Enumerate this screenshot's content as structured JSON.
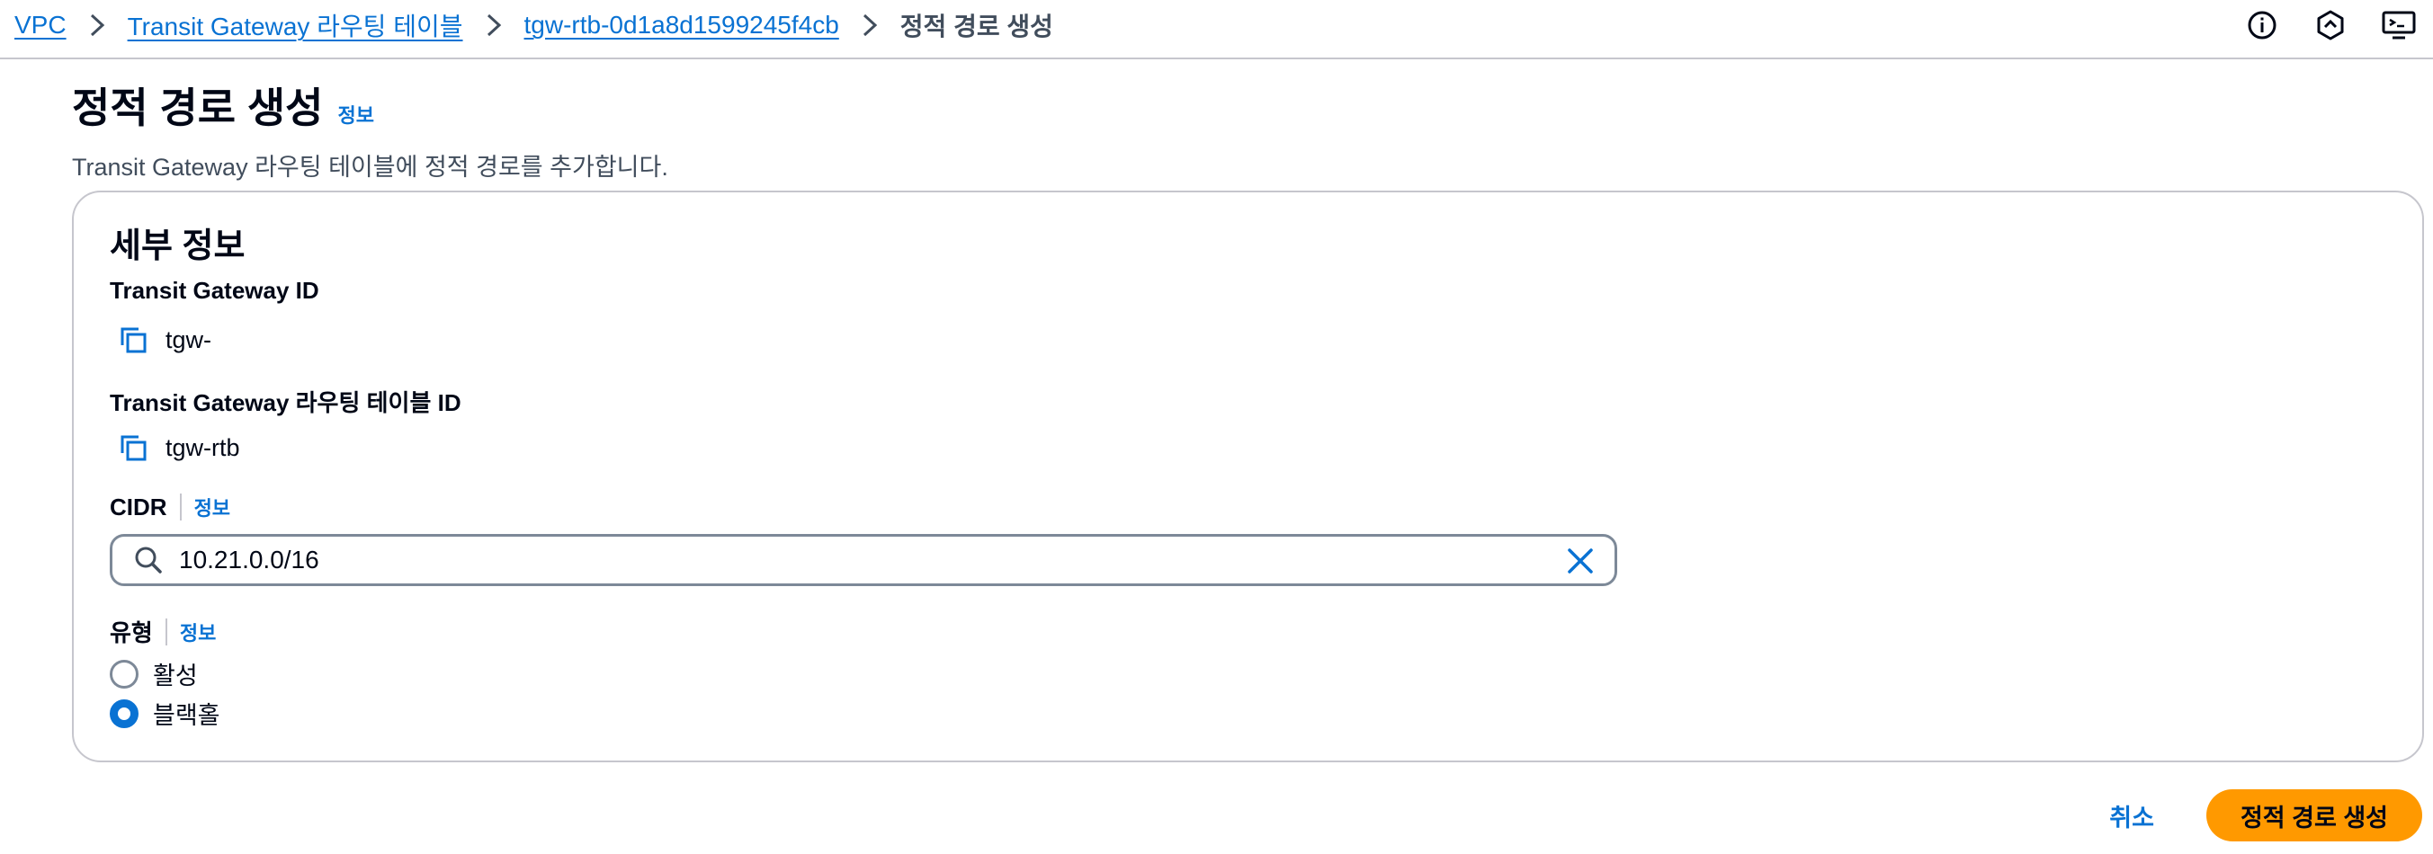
{
  "breadcrumb": {
    "items": [
      "VPC",
      "Transit Gateway 라우팅 테이블",
      "tgw-rtb-0d1a8d1599245f4cb"
    ],
    "current": "정적 경로 생성"
  },
  "header": {
    "title": "정적 경로 생성",
    "info_label": "정보",
    "description": "Transit Gateway 라우팅 테이블에 정적 경로를 추가합니다."
  },
  "details": {
    "section_title": "세부 정보",
    "tgw_id_label": "Transit Gateway ID",
    "tgw_id_value": "tgw-",
    "rtb_id_label": "Transit Gateway 라우팅 테이블 ID",
    "rtb_id_value": "tgw-rtb",
    "cidr_label": "CIDR",
    "cidr_info": "정보",
    "cidr_value": "10.21.0.0/16",
    "type_label": "유형",
    "type_info": "정보",
    "type_options": [
      {
        "label": "활성",
        "selected": false
      },
      {
        "label": "블랙홀",
        "selected": true
      }
    ]
  },
  "actions": {
    "cancel_label": "취소",
    "submit_label": "정적 경로 생성"
  },
  "icons": {
    "top": [
      "info-circle-icon",
      "hexagon-settings-icon",
      "monitor-icon"
    ],
    "copy": "copy-icon",
    "search": "search-icon",
    "clear": "close-icon"
  },
  "colors": {
    "link": "#0972d3",
    "primary_button": "#ff9900",
    "border": "#c6c6cd",
    "text": "#000716"
  }
}
